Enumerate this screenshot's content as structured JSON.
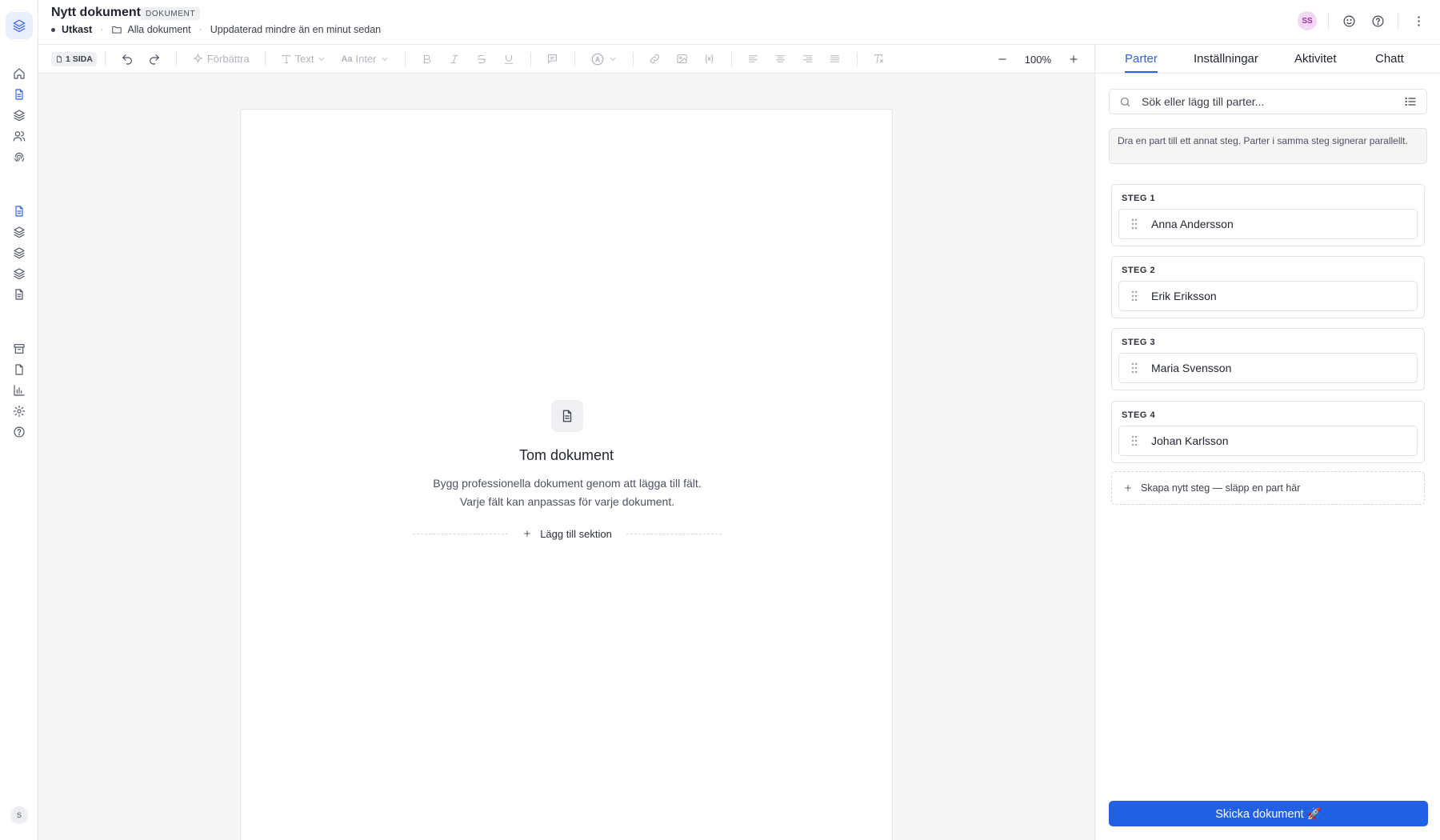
{
  "header": {
    "title": "Nytt dokument",
    "badge": "DOKUMENT",
    "status": "Utkast",
    "folder": "Alla dokument",
    "updated": "Uppdaterad mindre än en minut sedan",
    "avatar_initials": "SS"
  },
  "rail": {
    "avatar_initial": "S"
  },
  "toolbar": {
    "pages_label": "1 SIDA",
    "improve_label": "Förbättra",
    "text_style_label": "Text",
    "font_label": "Inter",
    "zoom_level": "100%"
  },
  "canvas": {
    "empty_title": "Tom dokument",
    "empty_description": "Bygg professionella dokument genom att lägga till fält. Varje fält kan anpassas för varje dokument.",
    "add_section_label": "Lägg till sektion"
  },
  "panel": {
    "tabs": [
      {
        "label": "Parter",
        "active": true
      },
      {
        "label": "Inställningar",
        "active": false
      },
      {
        "label": "Aktivitet",
        "active": false
      },
      {
        "label": "Chatt",
        "active": false
      }
    ],
    "search_placeholder": "Sök eller lägg till parter...",
    "hint": "Dra en part till ett annat steg. Parter i samma steg signerar parallellt.",
    "steps": [
      {
        "label": "STEG 1",
        "party": "Anna Andersson"
      },
      {
        "label": "STEG 2",
        "party": "Erik Eriksson"
      },
      {
        "label": "STEG 3",
        "party": "Maria Svensson"
      },
      {
        "label": "STEG 4",
        "party": "Johan Karlsson"
      }
    ],
    "new_step_label": "Skapa nytt steg — släpp en part här",
    "send_label": "Skicka dokument 🚀"
  },
  "colors": {
    "accent": "#2f5fe8",
    "send_button": "#2160e5",
    "canvas_background": "#f5f5f6"
  }
}
